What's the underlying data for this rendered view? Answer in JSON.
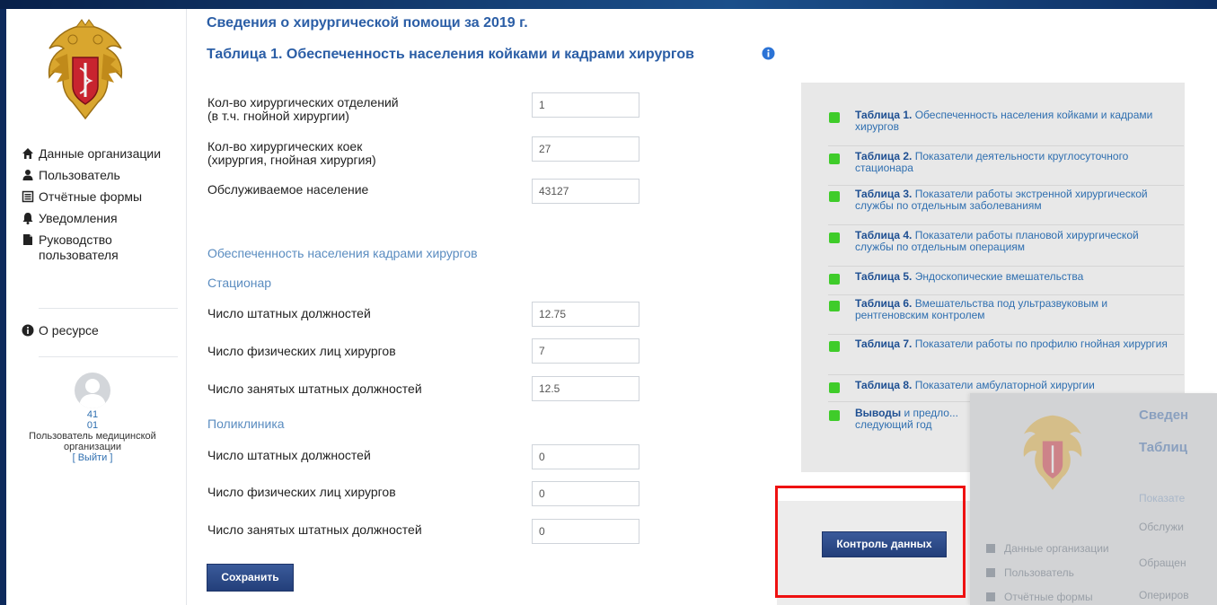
{
  "header": {
    "title": "Сведения о хирургической помощи за 2019 г.",
    "subtitle": "Таблица 1. Обеспеченность населения койками и кадрами хирургов"
  },
  "sidebar": {
    "items": [
      {
        "label": "Данные организации",
        "icon": "home-icon"
      },
      {
        "label": "Пользователь",
        "icon": "user-icon"
      },
      {
        "label": "Отчётные формы",
        "icon": "list-icon"
      },
      {
        "label": "Уведомления",
        "icon": "bell-icon"
      },
      {
        "label": "Руководство пользователя",
        "icon": "document-icon"
      }
    ],
    "about": {
      "label": "О ресурсе",
      "icon": "info-icon"
    },
    "user": {
      "line1": "41",
      "line2": "01",
      "role": "Пользователь медицинской организации",
      "logout": "[ Выйти ]"
    }
  },
  "form": {
    "rows_top": [
      {
        "label": "Кол-во хирургических отделений\n(в т.ч. гнойной хирургии)",
        "value": "1"
      },
      {
        "label": "Кол-во хирургических коек\n(хирургия, гнойная хирургия)",
        "value": "27"
      },
      {
        "label": "Обслуживаемое население",
        "value": "43127"
      }
    ],
    "section_title": "Обеспеченность населения кадрами хирургов",
    "stationary": {
      "title": "Стационар",
      "rows": [
        {
          "label": "Число штатных должностей",
          "value": "12.75"
        },
        {
          "label": "Число физических лиц хирургов",
          "value": "7"
        },
        {
          "label": "Число занятых штатных должностей",
          "value": "12.5"
        }
      ]
    },
    "polyclinic": {
      "title": "Поликлиника",
      "rows": [
        {
          "label": "Число штатных должностей",
          "value": "0"
        },
        {
          "label": "Число физических лиц хирургов",
          "value": "0"
        },
        {
          "label": "Число занятых штатных должностей",
          "value": "0"
        }
      ]
    },
    "save_label": "Сохранить"
  },
  "tables": [
    {
      "name": "Таблица 1.",
      "desc": " Обеспеченность населения койками и кадрами хирургов"
    },
    {
      "name": "Таблица 2.",
      "desc": " Показатели деятельности круглосуточного стационара"
    },
    {
      "name": "Таблица 3.",
      "desc": " Показатели работы экстренной хирургической службы по отдельным заболеваниям"
    },
    {
      "name": "Таблица 4.",
      "desc": " Показатели работы плановой хирургической службы по отдельным операциям"
    },
    {
      "name": "Таблица 5.",
      "desc": " Эндоскопические вмешательства"
    },
    {
      "name": "Таблица 6.",
      "desc": " Вмешательства под ультразвуковым и рентгеновским контролем"
    },
    {
      "name": "Таблица 7.",
      "desc": " Показатели работы по профилю гнойная хирургия"
    },
    {
      "name": "Таблица 8.",
      "desc": " Показатели амбулаторной хирургии"
    },
    {
      "name": "Выводы",
      "desc": " и предло... следующий год"
    }
  ],
  "control_label": "Контроль данных",
  "overlay": {
    "title1": "Сведен",
    "title2": "Таблиц",
    "nav": [
      "Данные организации",
      "Пользователь",
      "Отчётные формы"
    ],
    "lines": [
      "Показате",
      "Обслужи",
      "Обращен",
      "Опериров"
    ]
  },
  "colors": {
    "accent": "#2b5ea6",
    "status_ok": "#3fcc2a",
    "highlight": "#ee1111",
    "button": "#2a467f"
  }
}
